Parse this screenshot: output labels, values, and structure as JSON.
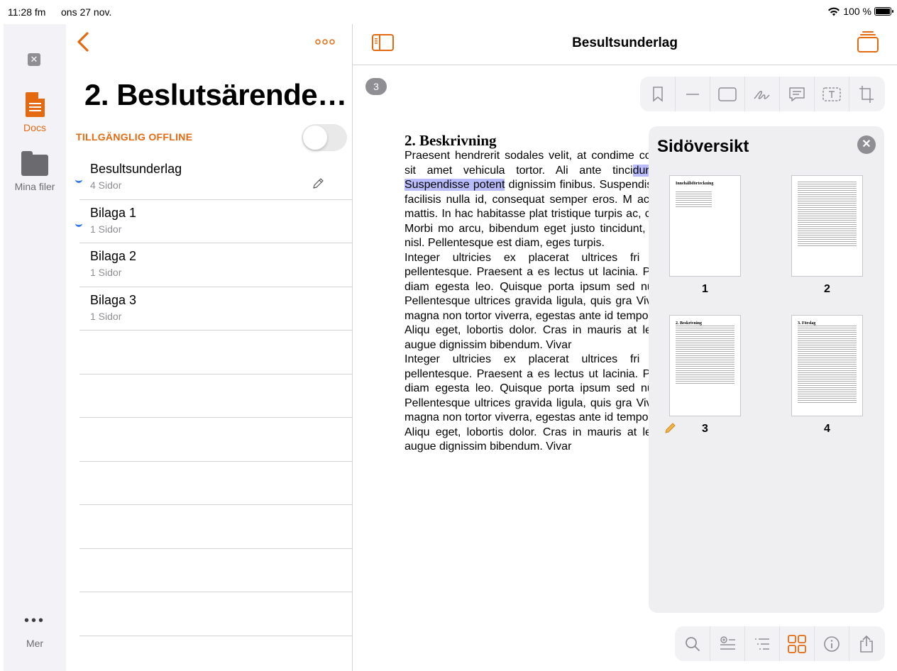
{
  "status_bar": {
    "time": "11:28 fm",
    "date": "ons 27 nov.",
    "battery": "100 %"
  },
  "rail": {
    "docs_label": "Docs",
    "files_label": "Mina filer",
    "more_label": "Mer"
  },
  "list": {
    "title": "2. Beslutsärende…",
    "offline_label": "TILLGÄNGLIG OFFLINE",
    "offline_enabled": false,
    "items": [
      {
        "name": "Besultsunderlag",
        "pages": "4 Sidor"
      },
      {
        "name": "Bilaga 1",
        "pages": "1 Sidor"
      },
      {
        "name": "Bilaga 2",
        "pages": "1 Sidor"
      },
      {
        "name": "Bilaga 3",
        "pages": "1 Sidor"
      }
    ]
  },
  "viewer": {
    "title": "Besultsunderlag",
    "page_badge": "3",
    "doc_heading": "2. Beskrivning",
    "para1_pre": "Praesent hendrerit sodales velit, at condime consequat nisl, sit amet vehicula tortor. Ali ante tinci",
    "para1_highlight": "dunt sit amet. Suspendisse potent",
    "para1_post": " dignissim finibus. Suspendisse sed ligula facilisis nulla id, consequat semper eros. M ac faucibus est mattis. In hac habitasse plat tristique turpis ac, cursus neque. Morbi mo arcu, bibendum eget justo tincidunt, pha tincidunt nisl. Pellentesque est diam, eges turpis.",
    "para2": "Integer ultricies ex placerat ultrices fri pellentesque pellentesque. Praesent a es lectus ut lacinia. Praesent vitae diam egesta leo. Quisque porta ipsum sed nulla varius fe Pellentesque ultrices gravida ligula, quis gra Vivamus finibus magna non tortor viverra, egestas ante id tempor consectetur. Aliqu eget, lobortis dolor. Cras in mauris at lect ligula nec augue dignissim bibendum. Vivar",
    "para3": "Integer ultricies ex placerat ultrices fri pellentesque pellentesque. Praesent a es lectus ut lacinia. Praesent vitae diam egesta leo. Quisque porta ipsum sed nulla varius fe Pellentesque ultrices gravida ligula, quis gra Vivamus finibus magna non tortor viverra, egestas ante id tempor consectetur. Aliqu eget, lobortis dolor. Cras in mauris at lect ligula nec augue dignissim bibendum. Vivar"
  },
  "overview": {
    "title": "Sidöversikt",
    "thumb_toc_title": "Innehållsförteckning",
    "thumb_p3_title": "2. Beskrivning",
    "thumb_p4_title": "3. Förslag",
    "pages": [
      "1",
      "2",
      "3",
      "4"
    ]
  },
  "colors": {
    "accent": "#e46a12",
    "highlight": "#b8bcfb",
    "unread_dot": "#3478f6"
  }
}
